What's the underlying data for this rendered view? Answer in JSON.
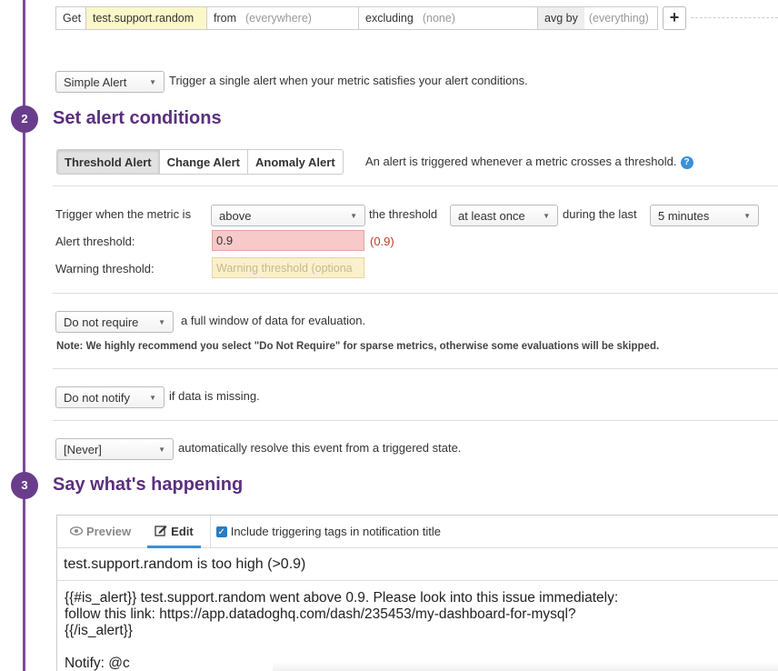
{
  "query": {
    "get_label": "Get",
    "metric": "test.support.random",
    "from_label": "from",
    "from_value": "(everywhere)",
    "excluding_label": "excluding",
    "excluding_value": "(none)",
    "avgby_label": "avg by",
    "avgby_value": "(everything)",
    "add_symbol": "+"
  },
  "alert_type": {
    "selected": "Simple Alert",
    "description": "Trigger a single alert when your metric satisfies your alert conditions."
  },
  "step2": {
    "number": "2",
    "title": "Set alert conditions",
    "tabs": [
      "Threshold Alert",
      "Change Alert",
      "Anomaly Alert"
    ],
    "tab_description": "An alert is triggered whenever a metric crosses a threshold.",
    "help_symbol": "?",
    "trigger_label": "Trigger when the metric is",
    "comparison": "above",
    "threshold_label": "the threshold",
    "frequency": "at least once",
    "during_label": "during the last",
    "window": "5 minutes",
    "alert_threshold_label": "Alert threshold:",
    "alert_threshold_value": "0.9",
    "alert_threshold_echo": "(0.9)",
    "warning_threshold_label": "Warning threshold:",
    "warning_threshold_placeholder": "Warning threshold (optiona",
    "require_selected": "Do not require",
    "require_text": "a full window of data for evaluation.",
    "require_note": "Note: We highly recommend you select \"Do Not Require\" for sparse metrics, otherwise some evaluations will be skipped.",
    "notify_selected": "Do not notify",
    "notify_text": "if data is missing.",
    "resolve_selected": "[Never]",
    "resolve_text": "automatically resolve this event from a triggered state."
  },
  "step3": {
    "number": "3",
    "title": "Say what's happening",
    "preview_tab": "Preview",
    "edit_tab": "Edit",
    "include_tags_label": "Include triggering tags in notification title",
    "message_title": "test.support.random is too high (>0.9)",
    "body_lines": [
      "{{#is_alert}} test.support.random went above 0.9. Please look into this issue immediately:",
      "follow this link: https://app.datadoghq.com/dash/235453/my-dashboard-for-mysql?",
      "{{/is_alert}}",
      "",
      "Notify: @c"
    ]
  }
}
